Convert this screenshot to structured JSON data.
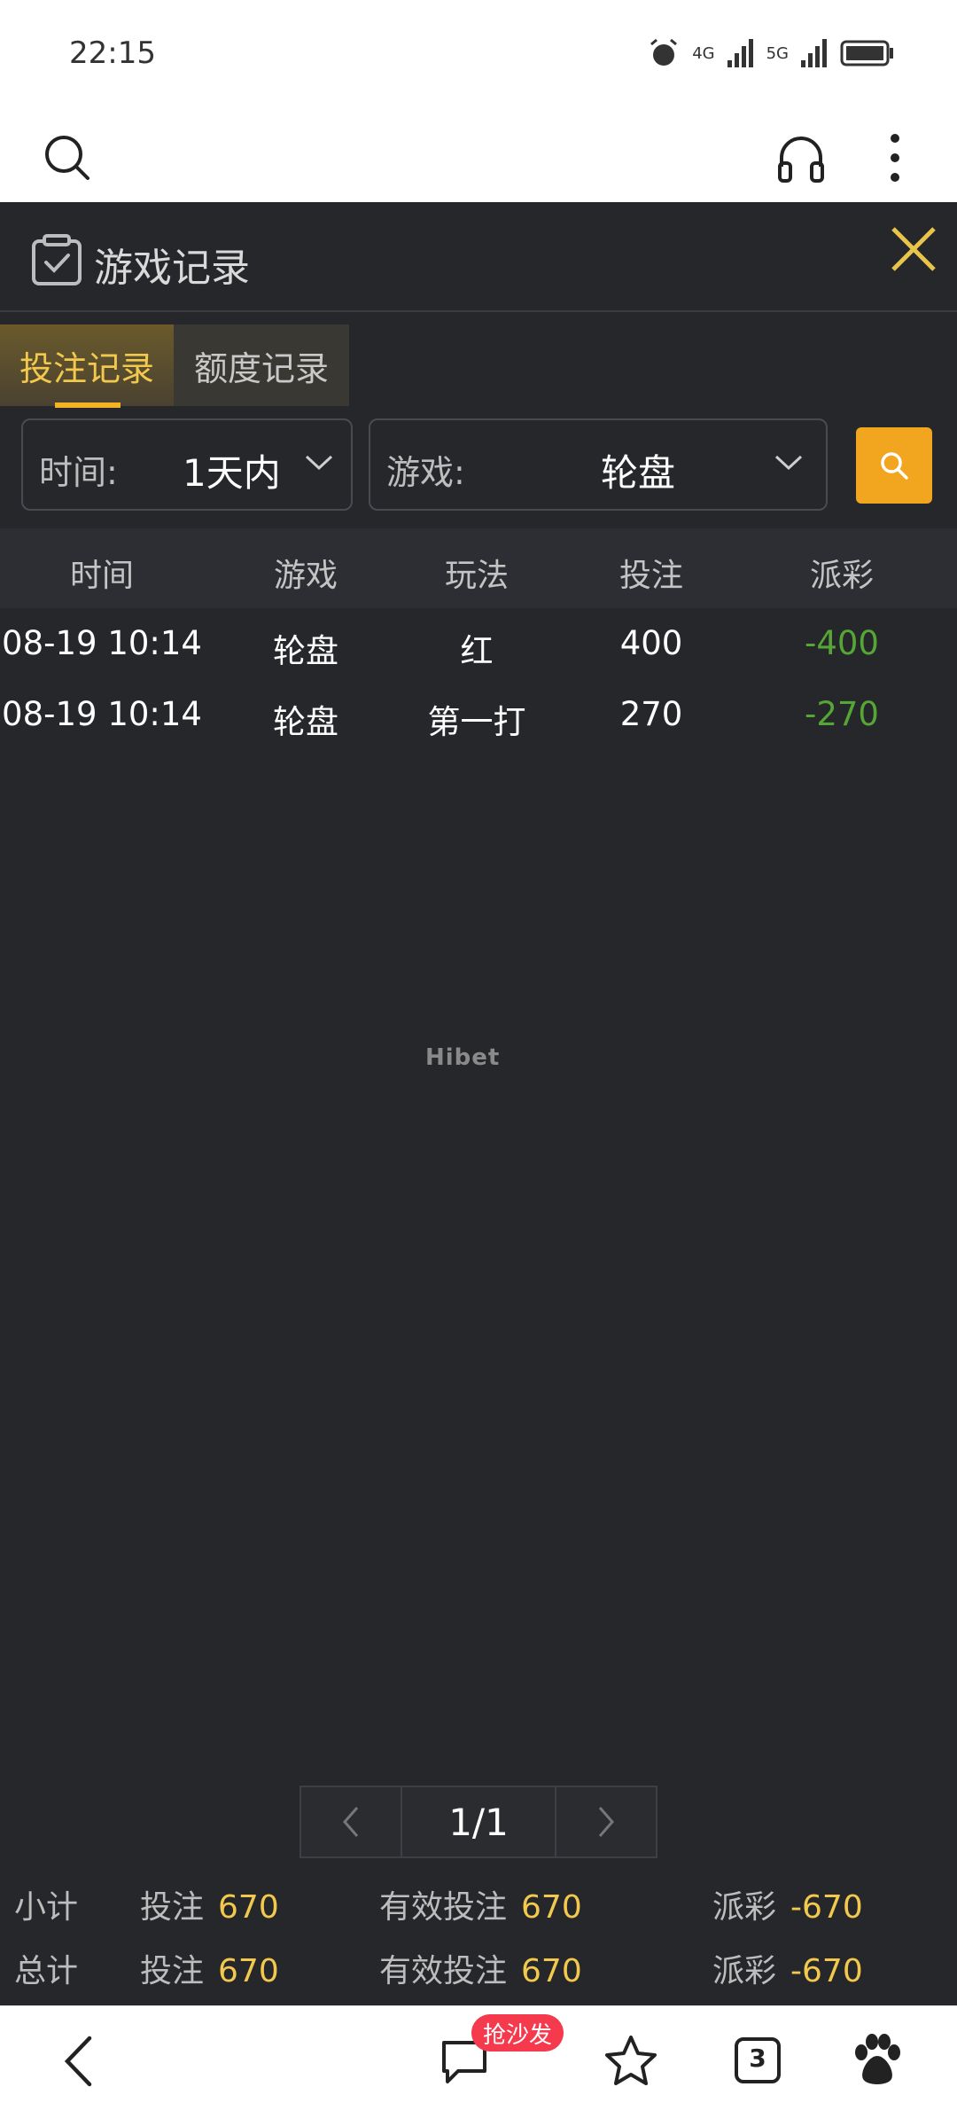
{
  "status_bar": {
    "time": "22:15",
    "signal_1": "4G",
    "signal_2": "5G"
  },
  "panel": {
    "title": "游戏记录",
    "tabs": [
      {
        "label": "投注记录",
        "active": true
      },
      {
        "label": "额度记录",
        "active": false
      }
    ],
    "filters": {
      "time_label": "时间:",
      "time_value": "1天内",
      "game_label": "游戏:",
      "game_value": "轮盘"
    },
    "table": {
      "headers": [
        "时间",
        "游戏",
        "玩法",
        "投注",
        "派彩"
      ],
      "rows": [
        [
          "08-19 10:14",
          "轮盘",
          "红",
          "400",
          "-400"
        ],
        [
          "08-19 10:14",
          "轮盘",
          "第一打",
          "270",
          "-270"
        ]
      ]
    },
    "watermark": "Hibet",
    "pagination": {
      "page": "1/1"
    },
    "summary": {
      "subtotal": {
        "label": "小计",
        "bet_label": "投注",
        "bet": "670",
        "valid_label": "有效投注",
        "valid": "670",
        "payout_label": "派彩",
        "payout": "-670"
      },
      "total": {
        "label": "总计",
        "bet_label": "投注",
        "bet": "670",
        "valid_label": "有效投注",
        "valid": "670",
        "payout_label": "派彩",
        "payout": "-670"
      }
    }
  },
  "bottom_nav": {
    "comment_badge": "抢沙发",
    "tab_count": "3"
  },
  "colors": {
    "panel_bg": "#26272b",
    "accent": "#f2b324",
    "negative": "#56a635",
    "badge": "#f53a4e"
  }
}
